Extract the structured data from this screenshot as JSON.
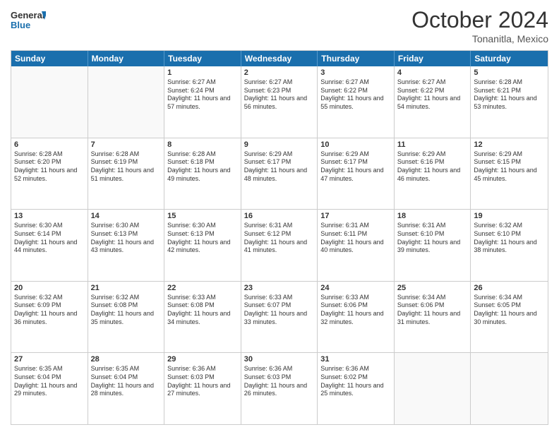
{
  "header": {
    "logo_line1": "General",
    "logo_line2": "Blue",
    "month": "October 2024",
    "location": "Tonanitla, Mexico"
  },
  "day_headers": [
    "Sunday",
    "Monday",
    "Tuesday",
    "Wednesday",
    "Thursday",
    "Friday",
    "Saturday"
  ],
  "weeks": [
    [
      {
        "day": "",
        "info": ""
      },
      {
        "day": "",
        "info": ""
      },
      {
        "day": "1",
        "info": "Sunrise: 6:27 AM\nSunset: 6:24 PM\nDaylight: 11 hours and 57 minutes."
      },
      {
        "day": "2",
        "info": "Sunrise: 6:27 AM\nSunset: 6:23 PM\nDaylight: 11 hours and 56 minutes."
      },
      {
        "day": "3",
        "info": "Sunrise: 6:27 AM\nSunset: 6:22 PM\nDaylight: 11 hours and 55 minutes."
      },
      {
        "day": "4",
        "info": "Sunrise: 6:27 AM\nSunset: 6:22 PM\nDaylight: 11 hours and 54 minutes."
      },
      {
        "day": "5",
        "info": "Sunrise: 6:28 AM\nSunset: 6:21 PM\nDaylight: 11 hours and 53 minutes."
      }
    ],
    [
      {
        "day": "6",
        "info": "Sunrise: 6:28 AM\nSunset: 6:20 PM\nDaylight: 11 hours and 52 minutes."
      },
      {
        "day": "7",
        "info": "Sunrise: 6:28 AM\nSunset: 6:19 PM\nDaylight: 11 hours and 51 minutes."
      },
      {
        "day": "8",
        "info": "Sunrise: 6:28 AM\nSunset: 6:18 PM\nDaylight: 11 hours and 49 minutes."
      },
      {
        "day": "9",
        "info": "Sunrise: 6:29 AM\nSunset: 6:17 PM\nDaylight: 11 hours and 48 minutes."
      },
      {
        "day": "10",
        "info": "Sunrise: 6:29 AM\nSunset: 6:17 PM\nDaylight: 11 hours and 47 minutes."
      },
      {
        "day": "11",
        "info": "Sunrise: 6:29 AM\nSunset: 6:16 PM\nDaylight: 11 hours and 46 minutes."
      },
      {
        "day": "12",
        "info": "Sunrise: 6:29 AM\nSunset: 6:15 PM\nDaylight: 11 hours and 45 minutes."
      }
    ],
    [
      {
        "day": "13",
        "info": "Sunrise: 6:30 AM\nSunset: 6:14 PM\nDaylight: 11 hours and 44 minutes."
      },
      {
        "day": "14",
        "info": "Sunrise: 6:30 AM\nSunset: 6:13 PM\nDaylight: 11 hours and 43 minutes."
      },
      {
        "day": "15",
        "info": "Sunrise: 6:30 AM\nSunset: 6:13 PM\nDaylight: 11 hours and 42 minutes."
      },
      {
        "day": "16",
        "info": "Sunrise: 6:31 AM\nSunset: 6:12 PM\nDaylight: 11 hours and 41 minutes."
      },
      {
        "day": "17",
        "info": "Sunrise: 6:31 AM\nSunset: 6:11 PM\nDaylight: 11 hours and 40 minutes."
      },
      {
        "day": "18",
        "info": "Sunrise: 6:31 AM\nSunset: 6:10 PM\nDaylight: 11 hours and 39 minutes."
      },
      {
        "day": "19",
        "info": "Sunrise: 6:32 AM\nSunset: 6:10 PM\nDaylight: 11 hours and 38 minutes."
      }
    ],
    [
      {
        "day": "20",
        "info": "Sunrise: 6:32 AM\nSunset: 6:09 PM\nDaylight: 11 hours and 36 minutes."
      },
      {
        "day": "21",
        "info": "Sunrise: 6:32 AM\nSunset: 6:08 PM\nDaylight: 11 hours and 35 minutes."
      },
      {
        "day": "22",
        "info": "Sunrise: 6:33 AM\nSunset: 6:08 PM\nDaylight: 11 hours and 34 minutes."
      },
      {
        "day": "23",
        "info": "Sunrise: 6:33 AM\nSunset: 6:07 PM\nDaylight: 11 hours and 33 minutes."
      },
      {
        "day": "24",
        "info": "Sunrise: 6:33 AM\nSunset: 6:06 PM\nDaylight: 11 hours and 32 minutes."
      },
      {
        "day": "25",
        "info": "Sunrise: 6:34 AM\nSunset: 6:06 PM\nDaylight: 11 hours and 31 minutes."
      },
      {
        "day": "26",
        "info": "Sunrise: 6:34 AM\nSunset: 6:05 PM\nDaylight: 11 hours and 30 minutes."
      }
    ],
    [
      {
        "day": "27",
        "info": "Sunrise: 6:35 AM\nSunset: 6:04 PM\nDaylight: 11 hours and 29 minutes."
      },
      {
        "day": "28",
        "info": "Sunrise: 6:35 AM\nSunset: 6:04 PM\nDaylight: 11 hours and 28 minutes."
      },
      {
        "day": "29",
        "info": "Sunrise: 6:36 AM\nSunset: 6:03 PM\nDaylight: 11 hours and 27 minutes."
      },
      {
        "day": "30",
        "info": "Sunrise: 6:36 AM\nSunset: 6:03 PM\nDaylight: 11 hours and 26 minutes."
      },
      {
        "day": "31",
        "info": "Sunrise: 6:36 AM\nSunset: 6:02 PM\nDaylight: 11 hours and 25 minutes."
      },
      {
        "day": "",
        "info": ""
      },
      {
        "day": "",
        "info": ""
      }
    ]
  ]
}
